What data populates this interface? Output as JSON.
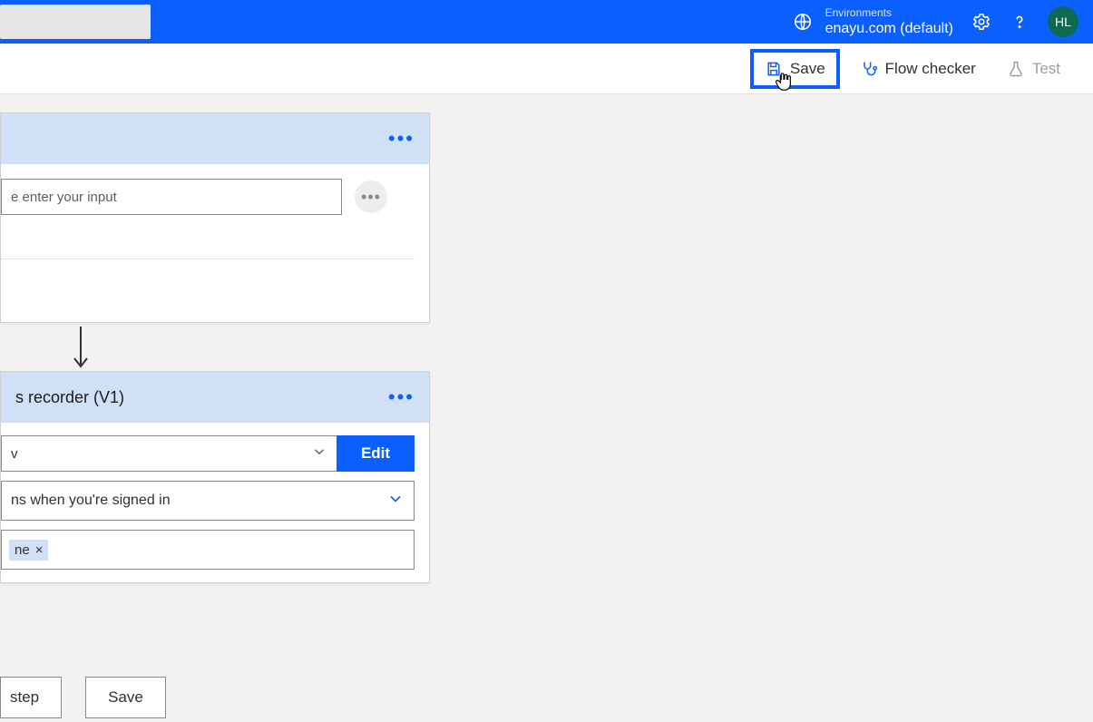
{
  "header": {
    "env_label": "Environments",
    "env_name": "enayu.com (default)",
    "avatar_initials": "HL"
  },
  "toolbar": {
    "save_label": "Save",
    "flow_checker_label": "Flow checker",
    "test_label": "Test"
  },
  "card1": {
    "input_placeholder": "e enter your input"
  },
  "card2": {
    "title_fragment": "s recorder (V1)",
    "dd1_text": "v",
    "edit_label": "Edit",
    "dd2_text": "ns when you're signed in",
    "token_text": "ne"
  },
  "bottom": {
    "step_label": "step",
    "save_label": "Save"
  }
}
